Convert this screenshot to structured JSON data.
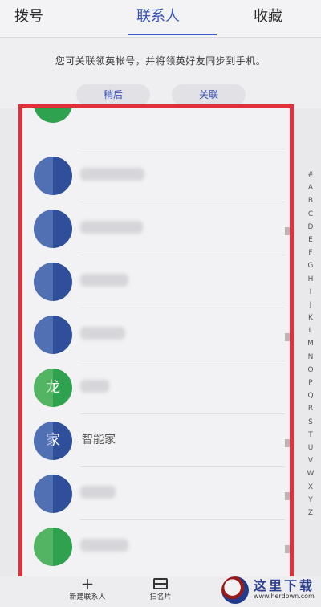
{
  "tabs": [
    {
      "label": "拨号",
      "active": false
    },
    {
      "label": "联系人",
      "active": true
    },
    {
      "label": "收藏",
      "active": false
    }
  ],
  "banner": {
    "message": "您可关联领英帐号，并将领英好友同步到手机。",
    "later_label": "稍后",
    "link_label": "关联"
  },
  "contacts": [
    {
      "avatar_text": "",
      "name_visible": "",
      "avatar_color": "#2fa24f",
      "has_doc_icon": false
    },
    {
      "avatar_text": "",
      "name_visible": "",
      "avatar_color": "#2f4f9a",
      "has_doc_icon": false
    },
    {
      "avatar_text": "",
      "name_visible": "",
      "avatar_color": "#2f4f9a",
      "has_doc_icon": true
    },
    {
      "avatar_text": "",
      "name_visible": "",
      "avatar_color": "#2f4f9a",
      "has_doc_icon": false
    },
    {
      "avatar_text": "",
      "name_visible": "",
      "avatar_color": "#2f4f9a",
      "has_doc_icon": true
    },
    {
      "avatar_text": "龙",
      "name_visible": "",
      "avatar_color": "#2fa24f",
      "has_doc_icon": false
    },
    {
      "avatar_text": "家",
      "name_visible": "智能家",
      "avatar_color": "#2f4f9a",
      "has_doc_icon": true
    },
    {
      "avatar_text": "",
      "name_visible": "",
      "avatar_color": "#2f4f9a",
      "has_doc_icon": true
    },
    {
      "avatar_text": "",
      "name_visible": "",
      "avatar_color": "#2fa24f",
      "has_doc_icon": true
    }
  ],
  "alpha_index": [
    "#",
    "A",
    "B",
    "C",
    "D",
    "E",
    "F",
    "G",
    "H",
    "I",
    "J",
    "K",
    "L",
    "M",
    "N",
    "O",
    "P",
    "Q",
    "R",
    "S",
    "T",
    "U",
    "V",
    "W",
    "X",
    "Y",
    "Z"
  ],
  "bottom": {
    "new_contact_label": "新建联系人",
    "scan_card_label": "扫名片"
  },
  "watermark": {
    "title": "这里下载",
    "url": "www.herdown.com"
  },
  "colors": {
    "accent": "#3353b6",
    "highlight_frame": "#e0303a"
  }
}
